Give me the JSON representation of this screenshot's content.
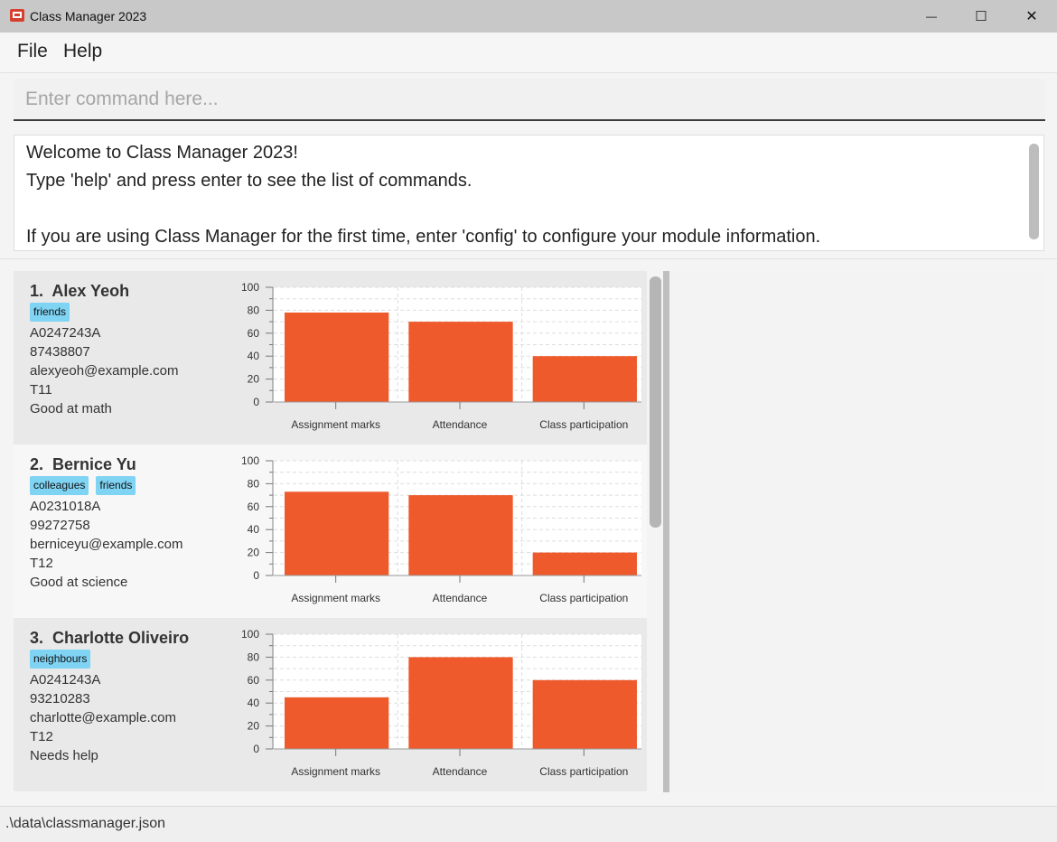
{
  "window": {
    "title": "Class Manager 2023",
    "minimize_glyph": "—",
    "maximize_glyph": "☐",
    "close_glyph": "✕",
    "icon": "app-logo-icon",
    "icon_color": "#d6402e"
  },
  "menu": [
    {
      "label": "File"
    },
    {
      "label": "Help"
    }
  ],
  "command": {
    "placeholder": "Enter command here...",
    "value": ""
  },
  "result": {
    "lines": [
      "Welcome to Class Manager 2023!",
      "Type 'help' and press enter to see the list of commands.",
      "",
      "If you are using Class Manager for the first time, enter 'config' to configure your module information."
    ]
  },
  "students": [
    {
      "index": "1.",
      "name": "Alex Yeoh",
      "tags": [
        "friends"
      ],
      "student_number": "A0247243A",
      "phone": "87438807",
      "email": "alexyeoh@example.com",
      "class_number": "T11",
      "comment": "Good at math",
      "chart_data": {
        "type": "bar",
        "categories": [
          "Assignment marks",
          "Attendance",
          "Class participation"
        ],
        "values": [
          78,
          70,
          40
        ],
        "ylim": [
          0,
          100
        ],
        "yticks": [
          "100",
          "80",
          "60",
          "40",
          "20",
          "0"
        ]
      }
    },
    {
      "index": "2.",
      "name": "Bernice Yu",
      "tags": [
        "colleagues",
        "friends"
      ],
      "student_number": "A0231018A",
      "phone": "99272758",
      "email": "berniceyu@example.com",
      "class_number": "T12",
      "comment": "Good at science",
      "chart_data": {
        "type": "bar",
        "categories": [
          "Assignment marks",
          "Attendance",
          "Class participation"
        ],
        "values": [
          73,
          70,
          20
        ],
        "ylim": [
          0,
          100
        ],
        "yticks": [
          "100",
          "80",
          "60",
          "40",
          "20",
          "0"
        ]
      }
    },
    {
      "index": "3.",
      "name": "Charlotte Oliveiro",
      "tags": [
        "neighbours"
      ],
      "student_number": "A0241243A",
      "phone": "93210283",
      "email": "charlotte@example.com",
      "class_number": "T12",
      "comment": "Needs help",
      "chart_data": {
        "type": "bar",
        "categories": [
          "Assignment marks",
          "Attendance",
          "Class participation"
        ],
        "values": [
          45,
          80,
          60
        ],
        "ylim": [
          0,
          100
        ],
        "yticks": [
          "100",
          "80",
          "60",
          "40",
          "20",
          "0"
        ]
      }
    }
  ],
  "colors": {
    "bar": "#ee5a2b",
    "tag": "#7fd3f3",
    "card_dark": "#e9e9e9",
    "card_light": "#f7f7f7"
  },
  "status": {
    "file_path": ".\\data\\classmanager.json"
  }
}
